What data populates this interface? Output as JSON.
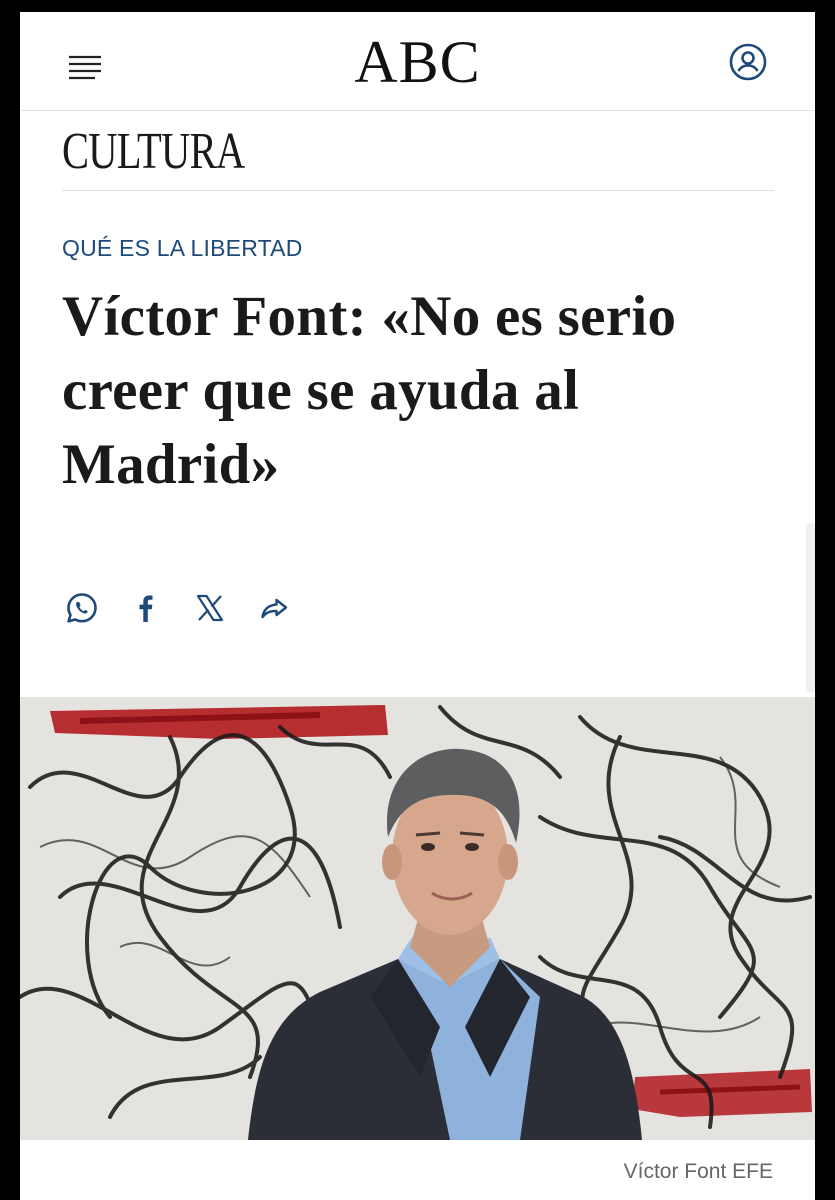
{
  "header": {
    "logo": "ABC",
    "menu_icon": "hamburger-menu-icon",
    "account_icon": "user-account-icon"
  },
  "section": {
    "title": "CULTURA"
  },
  "article": {
    "kicker": "QUÉ ES LA LIBERTAD",
    "headline": "Víctor Font: «No es serio creer que se ayuda al Madrid»",
    "share": [
      {
        "name": "whatsapp",
        "icon": "whatsapp-icon"
      },
      {
        "name": "facebook",
        "icon": "facebook-icon"
      },
      {
        "name": "x",
        "icon": "x-icon"
      },
      {
        "name": "share",
        "icon": "share-arrow-icon"
      }
    ],
    "photo_caption": "Víctor Font EFE"
  },
  "colors": {
    "kicker": "#1d4a7a",
    "text": "#1a1a1a",
    "caption": "#666666",
    "frame": "#000000"
  }
}
